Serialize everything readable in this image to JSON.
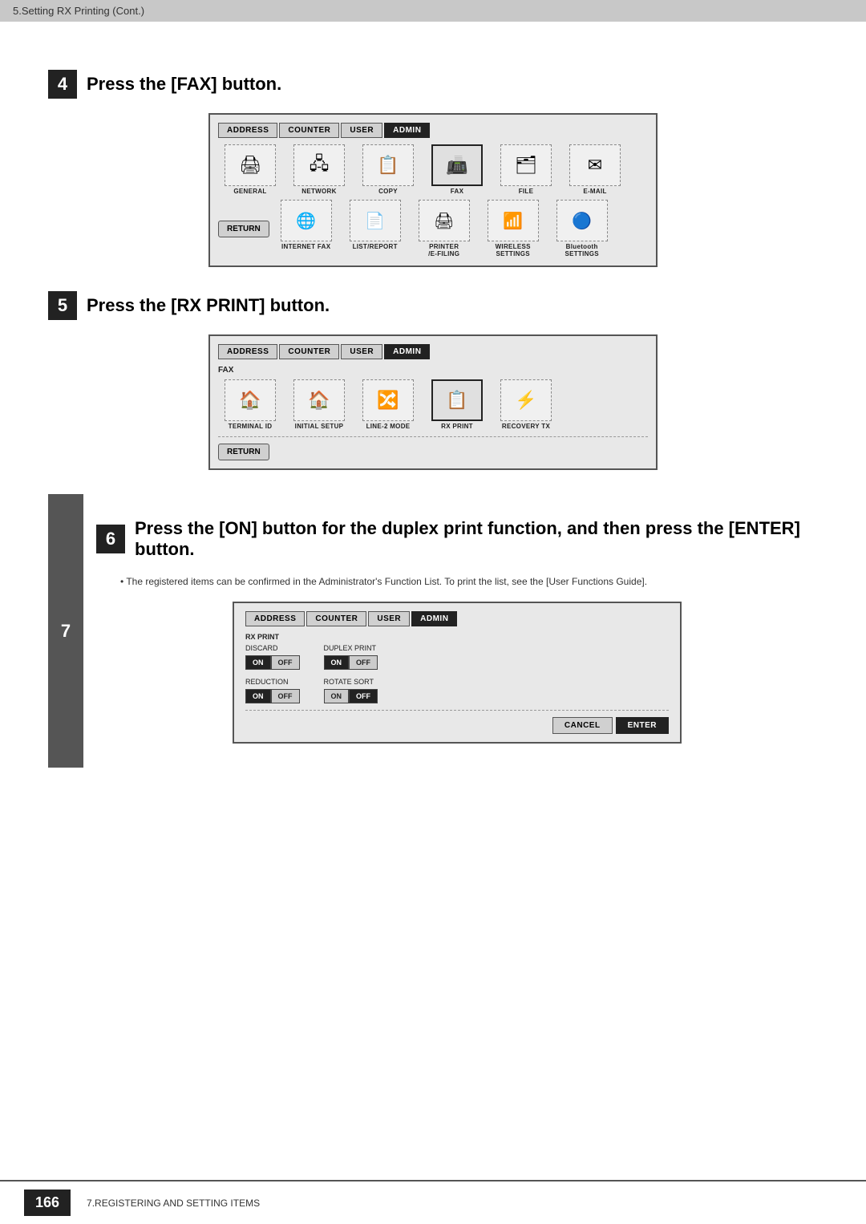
{
  "top_bar": {
    "text": "5.Setting RX Printing (Cont.)"
  },
  "step4": {
    "number": "4",
    "title": "Press the [FAX] button.",
    "panel": {
      "tabs": [
        "ADDRESS",
        "COUNTER",
        "USER",
        "ADMIN"
      ],
      "active_tab": "ADMIN",
      "icons": [
        {
          "label": "GENERAL",
          "symbol": "🖨",
          "highlighted": false
        },
        {
          "label": "NETWORK",
          "symbol": "🖧",
          "highlighted": false
        },
        {
          "label": "COPY",
          "symbol": "📋",
          "highlighted": false
        },
        {
          "label": "FAX",
          "symbol": "📠",
          "highlighted": true
        },
        {
          "label": "FILE",
          "symbol": "🗂",
          "highlighted": false
        },
        {
          "label": "E-MAIL",
          "symbol": "✉",
          "highlighted": false
        }
      ],
      "icons2": [
        {
          "label": "INTERNET FAX",
          "symbol": "🌐",
          "highlighted": false
        },
        {
          "label": "LIST/REPORT",
          "symbol": "📄",
          "highlighted": false
        },
        {
          "label": "PRINTER\n/E-FILING",
          "symbol": "🖨",
          "highlighted": false
        },
        {
          "label": "WIRELESS\nSETTINGS",
          "symbol": "📶",
          "highlighted": false
        },
        {
          "label": "Bluetooth\nSETTINGS",
          "symbol": "🔵",
          "highlighted": false
        }
      ],
      "return_label": "RETURN"
    }
  },
  "step5": {
    "number": "5",
    "title": "Press the [RX PRINT] button.",
    "panel": {
      "tabs": [
        "ADDRESS",
        "COUNTER",
        "USER",
        "ADMIN"
      ],
      "active_tab": "ADMIN",
      "fax_label": "FAX",
      "icons": [
        {
          "label": "TERMINAL ID",
          "symbol": "🏠",
          "highlighted": false
        },
        {
          "label": "INITIAL SETUP",
          "symbol": "🏠",
          "highlighted": false
        },
        {
          "label": "LINE-2 MODE",
          "symbol": "🔀",
          "highlighted": false
        },
        {
          "label": "RX PRINT",
          "symbol": "📋",
          "highlighted": true
        },
        {
          "label": "RECOVERY TX",
          "symbol": "⚡",
          "highlighted": false
        }
      ],
      "return_label": "RETURN"
    }
  },
  "step6_side": "7",
  "step6": {
    "number": "6",
    "title": "Press the [ON] button for the duplex print function, and then press the [ENTER] button.",
    "note": "The registered items can be confirmed in the Administrator's Function List. To print the list, see the [User Functions Guide].",
    "panel": {
      "tabs": [
        "ADDRESS",
        "COUNTER",
        "USER",
        "ADMIN"
      ],
      "active_tab": "ADMIN",
      "section_title": "RX PRINT",
      "discard_label": "DISCARD",
      "discard_on": "ON",
      "discard_off": "OFF",
      "discard_on_active": true,
      "duplex_label": "DUPLEX PRINT",
      "duplex_on": "ON",
      "duplex_off": "OFF",
      "duplex_on_active": true,
      "reduction_label": "REDUCTION",
      "reduction_on": "ON",
      "reduction_off": "OFF",
      "reduction_on_active": true,
      "rotate_label": "ROTATE SORT",
      "rotate_on": "ON",
      "rotate_off": "OFF",
      "rotate_off_active": true,
      "cancel_label": "CANCEL",
      "enter_label": "ENTER"
    }
  },
  "footer": {
    "page_number": "166",
    "text": "7.REGISTERING AND SETTING ITEMS"
  }
}
